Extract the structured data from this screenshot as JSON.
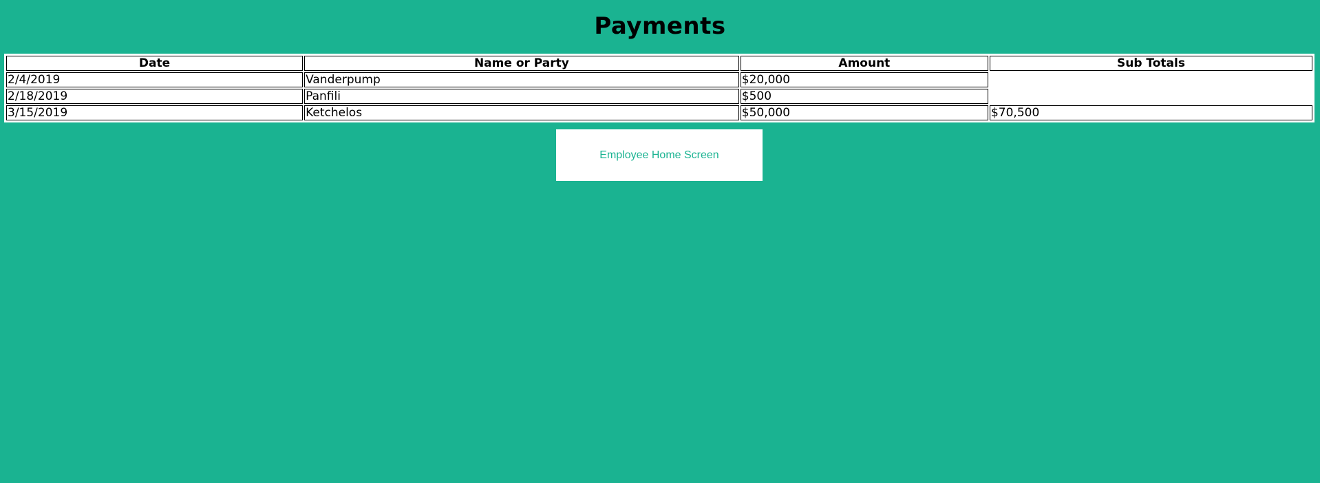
{
  "page": {
    "title": "Payments"
  },
  "table": {
    "headers": [
      "Date",
      "Name or Party",
      "Amount",
      "Sub Totals"
    ],
    "rows": [
      {
        "date": "2/4/2019",
        "name": "Vanderpump",
        "amount": "$20,000",
        "subtotal": ""
      },
      {
        "date": "2/18/2019",
        "name": "Panfili",
        "amount": "$500",
        "subtotal": ""
      },
      {
        "date": "3/15/2019",
        "name": "Ketchelos",
        "amount": "$50,000",
        "subtotal": "$70,500"
      }
    ]
  },
  "nav": {
    "home_button_label": "Employee Home Screen"
  },
  "colors": {
    "background": "#1ab391",
    "button_text": "#1ab391",
    "table_background": "#ffffff"
  }
}
